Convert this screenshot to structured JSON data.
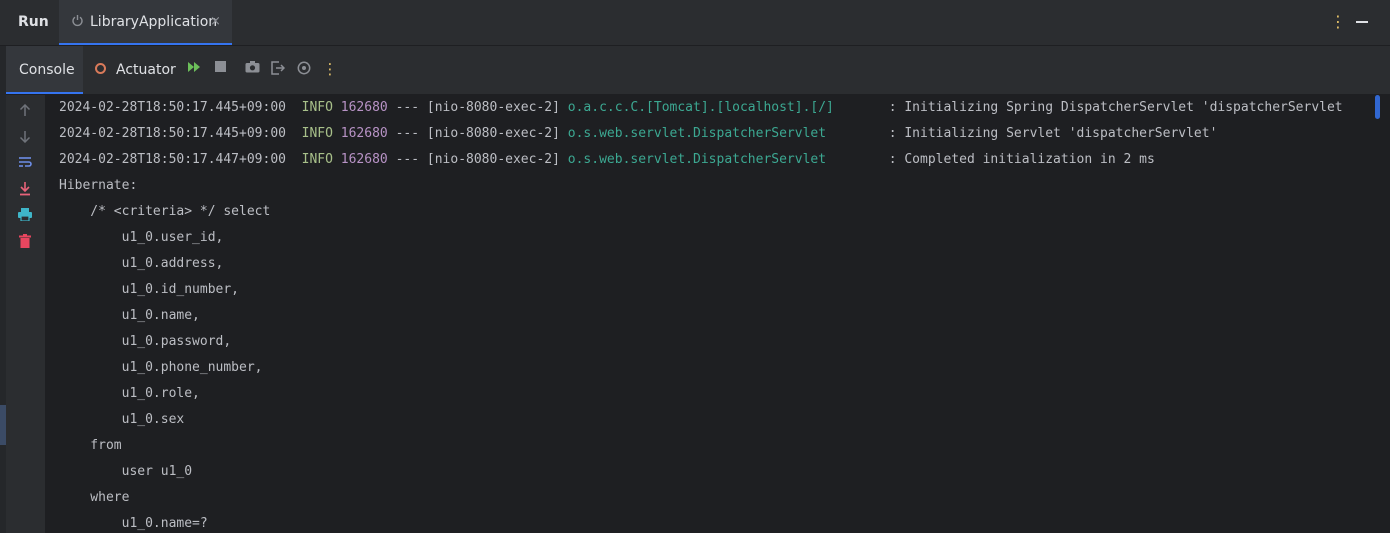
{
  "header": {
    "panel_title": "Run",
    "tab_label": "LibraryApplication",
    "tab_close": "×",
    "more_icon": "⋮",
    "minimize_icon": "minimize-icon"
  },
  "toolbar": {
    "console_label": "Console",
    "actuator_label": "Actuator",
    "icons": [
      "rerun-icon",
      "stop-icon",
      "screenshot-icon",
      "exit-icon",
      "settings-icon",
      "more-icon"
    ]
  },
  "gutter_icons": [
    "arrow-up-icon",
    "arrow-down-icon",
    "soft-wrap-icon",
    "scroll-to-end-icon",
    "print-icon",
    "trash-icon"
  ],
  "colors": {
    "accent": "#3574f0",
    "log_level": "#a8c08a",
    "pid": "#b893c6",
    "logger": "#3ca892"
  },
  "log_entries": [
    {
      "ts": "2024-02-28T18:50:17.445+09:00",
      "level": "INFO",
      "pid": "162680",
      "sep": "---",
      "thread": "[nio-8080-exec-2]",
      "logger": "o.a.c.c.C.[Tomcat].[localhost].[/]      ",
      "message": ": Initializing Spring DispatcherServlet 'dispatcherServlet"
    },
    {
      "ts": "2024-02-28T18:50:17.445+09:00",
      "level": "INFO",
      "pid": "162680",
      "sep": "---",
      "thread": "[nio-8080-exec-2]",
      "logger": "o.s.web.servlet.DispatcherServlet       ",
      "message": ": Initializing Servlet 'dispatcherServlet'"
    },
    {
      "ts": "2024-02-28T18:50:17.447+09:00",
      "level": "INFO",
      "pid": "162680",
      "sep": "---",
      "thread": "[nio-8080-exec-2]",
      "logger": "o.s.web.servlet.DispatcherServlet       ",
      "message": ": Completed initialization in 2 ms"
    }
  ],
  "hibernate_lines": [
    "Hibernate:",
    "    /* <criteria> */ select",
    "        u1_0.user_id,",
    "        u1_0.address,",
    "        u1_0.id_number,",
    "        u1_0.name,",
    "        u1_0.password,",
    "        u1_0.phone_number,",
    "        u1_0.role,",
    "        u1_0.sex",
    "    from",
    "        user u1_0",
    "    where",
    "        u1_0.name=?"
  ]
}
